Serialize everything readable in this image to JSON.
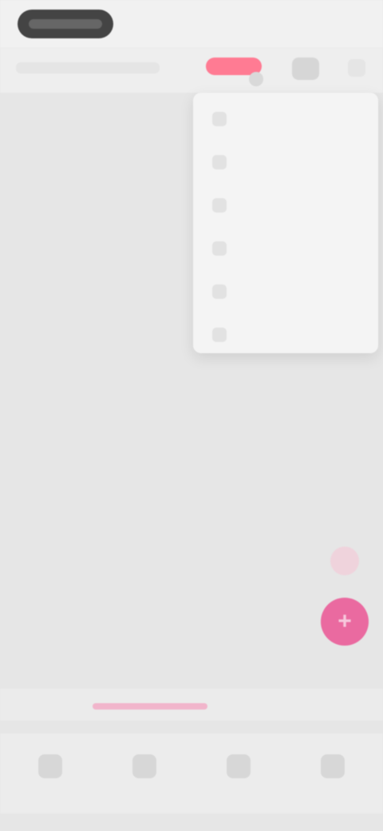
{
  "app": {
    "title": ""
  },
  "colors": {
    "accent": "#ea6aa0",
    "accent_light": "#efd3dc",
    "menu_bg": "#f4f4f4",
    "screen_bg": "#e6e6e6"
  },
  "header": {
    "brand_badge": "",
    "subtitle": ""
  },
  "menu": {
    "items": [
      {
        "label": "",
        "icon": "menu-item-icon"
      },
      {
        "label": "",
        "icon": "menu-item-icon"
      },
      {
        "label": "",
        "icon": "menu-item-icon"
      },
      {
        "label": "",
        "icon": "menu-item-icon"
      },
      {
        "label": "",
        "icon": "menu-item-icon"
      },
      {
        "label": "",
        "icon": "menu-item-icon"
      }
    ]
  },
  "sub_tabs": {
    "items": [
      {
        "label": ""
      },
      {
        "label": ""
      },
      {
        "label": ""
      }
    ],
    "active_index": 1
  },
  "bottom_nav": {
    "items": [
      {
        "label": ""
      },
      {
        "label": ""
      },
      {
        "label": ""
      },
      {
        "label": ""
      }
    ]
  }
}
